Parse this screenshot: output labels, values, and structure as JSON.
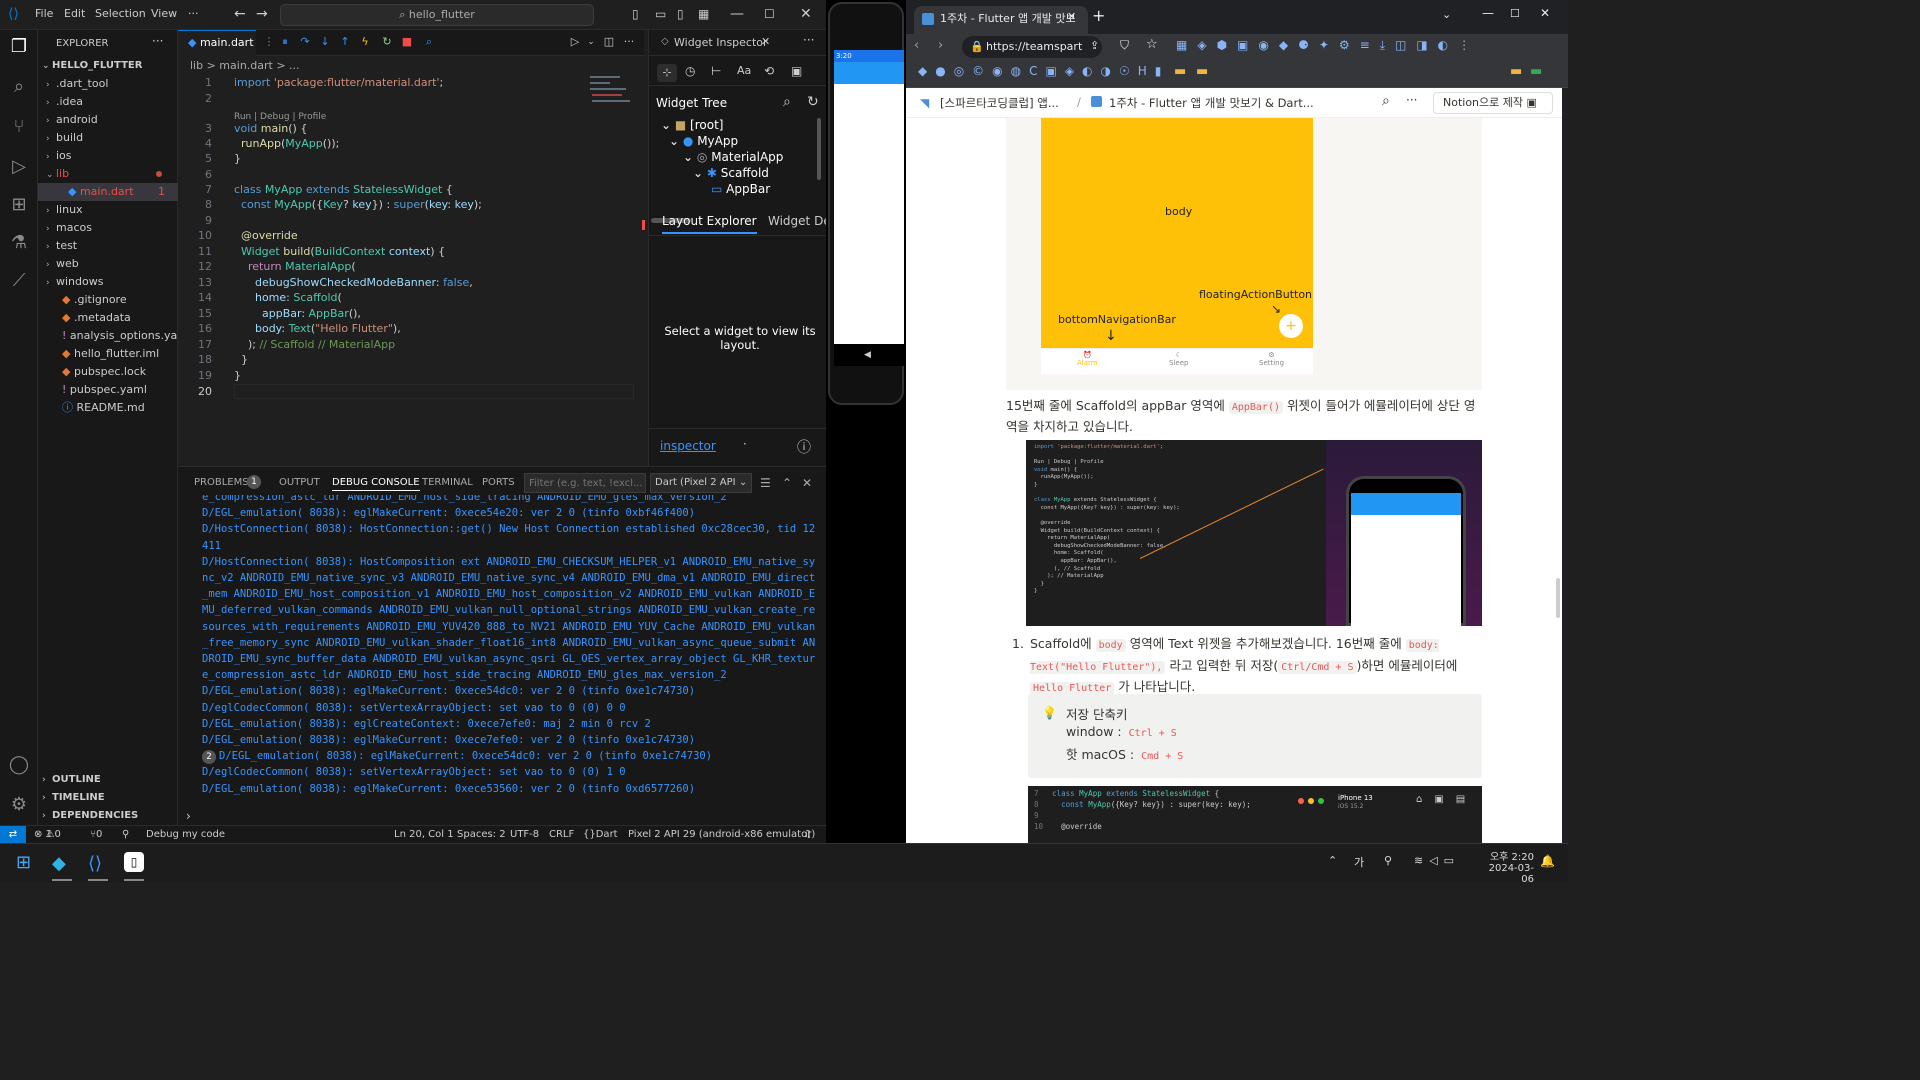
{
  "vscode": {
    "menu": [
      "File",
      "Edit",
      "Selection",
      "View",
      "···"
    ],
    "search_text": "hello_flutter",
    "explorer": {
      "title": "EXPLORER",
      "root": "HELLO_FLUTTER",
      "items": [
        {
          "label": ".dart_tool",
          "type": "folder"
        },
        {
          "label": ".idea",
          "type": "folder"
        },
        {
          "label": "android",
          "type": "folder"
        },
        {
          "label": "build",
          "type": "folder"
        },
        {
          "label": "ios",
          "type": "folder"
        },
        {
          "label": "lib",
          "type": "folder-open"
        },
        {
          "label": "main.dart",
          "type": "file-selected",
          "badge": "1"
        },
        {
          "label": "linux",
          "type": "folder"
        },
        {
          "label": "macos",
          "type": "folder"
        },
        {
          "label": "test",
          "type": "folder"
        },
        {
          "label": "web",
          "type": "folder"
        },
        {
          "label": "windows",
          "type": "folder"
        },
        {
          "label": ".gitignore",
          "type": "file"
        },
        {
          "label": ".metadata",
          "type": "file"
        },
        {
          "label": "analysis_options.yaml",
          "type": "file"
        },
        {
          "label": "hello_flutter.iml",
          "type": "file"
        },
        {
          "label": "pubspec.lock",
          "type": "file"
        },
        {
          "label": "pubspec.yaml",
          "type": "file"
        },
        {
          "label": "README.md",
          "type": "file"
        }
      ],
      "outline": "OUTLINE",
      "timeline": "TIMELINE",
      "dependencies": "DEPENDENCIES"
    },
    "editor": {
      "tab": "main.dart",
      "breadcrumb": "lib > main.dart > ...",
      "codelens": "Run | Debug | Profile",
      "lines": [
        "1",
        "2",
        "",
        "3",
        "4",
        "5",
        "6",
        "7",
        "8",
        "9",
        "10",
        "11",
        "12",
        "13",
        "14",
        "15",
        "16",
        "17",
        "18",
        "19",
        "20"
      ]
    },
    "inspector": {
      "tab": "Widget Inspector",
      "tree_title": "Widget Tree",
      "tree": [
        "[root]",
        "MyApp",
        "MaterialApp",
        "Scaffold",
        "AppBar"
      ],
      "tabs": [
        "Layout Explorer",
        "Widget Det"
      ],
      "message": "Select a widget to view its layout.",
      "footer_link": "inspector"
    },
    "panel": {
      "tabs": [
        "PROBLEMS",
        "OUTPUT",
        "DEBUG CONSOLE",
        "TERMINAL",
        "PORTS"
      ],
      "problems_count": "1",
      "filter_placeholder": "Filter (e.g. text, !excl...",
      "device_select": "Dart (Pixel 2 API",
      "log": [
        "e_compression_astc_ldr ANDROID_EMU_host_side_tracing ANDROID_EMU_gles_max_version_2",
        "D/EGL_emulation( 8038): eglMakeCurrent: 0xece54e20: ver 2 0 (tinfo 0xbf46f400)",
        "D/HostConnection( 8038): HostConnection::get() New Host Connection established 0xc28cec30, tid 12411",
        "D/HostConnection( 8038): HostComposition ext ANDROID_EMU_CHECKSUM_HELPER_v1 ANDROID_EMU_native_sync_v2 ANDROID_EMU_native_sync_v3 ANDROID_EMU_native_sync_v4 ANDROID_EMU_dma_v1 ANDROID_EMU_direct_mem ANDROID_EMU_host_composition_v1 ANDROID_EMU_host_composition_v2 ANDROID_EMU_vulkan ANDROID_EMU_deferred_vulkan_commands ANDROID_EMU_vulkan_null_optional_strings ANDROID_EMU_vulkan_create_resources_with_requirements ANDROID_EMU_YUV420_888_to_NV21 ANDROID_EMU_YUV_Cache ANDROID_EMU_vulkan_free_memory_sync ANDROID_EMU_vulkan_shader_float16_int8 ANDROID_EMU_vulkan_async_queue_submit ANDROID_EMU_sync_buffer_data ANDROID_EMU_vulkan_async_qsri GL_OES_vertex_array_object GL_KHR_texture_compression_astc_ldr ANDROID_EMU_host_side_tracing ANDROID_EMU_gles_max_version_2",
        "D/EGL_emulation( 8038): eglMakeCurrent: 0xece54dc0: ver 2 0 (tinfo 0xe1c74730)",
        "D/eglCodecCommon( 8038): setVertexArrayObject: set vao to 0 (0) 0 0",
        "D/EGL_emulation( 8038): eglCreateContext: 0xece7efe0: maj 2 min 0 rcv 2",
        "D/EGL_emulation( 8038): eglMakeCurrent: 0xece7efe0: ver 2 0 (tinfo 0xe1c74730)",
        "D/EGL_emulation( 8038): eglMakeCurrent: 0xece54dc0: ver 2 0 (tinfo 0xe1c74730)",
        "D/eglCodecCommon( 8038): setVertexArrayObject: set vao to 0 (0) 1 0",
        "D/EGL_emulation( 8038): eglMakeCurrent: 0xece53560: ver 2 0 (tinfo 0xd6577260)"
      ],
      "repeat_badge": "2"
    },
    "status": {
      "errors": "1",
      "warnings": "0",
      "ports": "0",
      "debug": "Debug my code",
      "position": "Ln 20, Col 1",
      "spaces": "Spaces: 2",
      "encoding": "UTF-8",
      "eol": "CRLF",
      "language": "Dart",
      "device": "Pixel 2 API 29 (android-x86 emulator)"
    }
  },
  "emulator": {
    "clock": "3:20"
  },
  "browser": {
    "tab_title": "1주차 - Flutter 앱 개발 맛보",
    "url": "https://teamspart",
    "notion_breadcrumb_1": "[스파르타코딩클럽] 앱...",
    "notion_breadcrumb_2": "1주차 - Flutter 앱 개발 맛보기 & Dart...",
    "notion_button": "Notion으로 제작",
    "diagram": {
      "body": "body",
      "fab": "floatingActionButton",
      "nav": "bottomNavigationBar",
      "nav_items": [
        "Alarm",
        "Sleep",
        "Setting"
      ]
    },
    "para1_a": "15번째 줄에 Scaffold의 appBar 영역에",
    "para1_code": "AppBar()",
    "para1_b": "위젯이 들어가 에뮬레이터에 상단 영역을 차지하고 있습니다.",
    "step": "1.",
    "para2_a": "Scaffold에",
    "para2_code1": "body",
    "para2_b": "영역에 Text 위젯을 추가해보겠습니다. 16번째 줄에",
    "para2_code2": "body: Text(\"Hello Flutter\"),",
    "para2_c": "라고 입력한 뒤 저장(",
    "para2_code3": "Ctrl/Cmd + S",
    "para2_d": ")하면 에뮬레이터에",
    "para2_code4": "Hello Flutter",
    "para2_e": "가 나타납니다.",
    "callout_title": "저장 단축키",
    "callout_win": "window :",
    "callout_win_key": "Ctrl + S",
    "callout_mac": "핫 macOS :",
    "callout_mac_key": "Cmd + S",
    "iphone_label": "iPhone 13",
    "iphone_sub": "iOS 15.2"
  },
  "taskbar": {
    "ime": "가",
    "time": "오후 2:20",
    "date": "2024-03-06"
  }
}
